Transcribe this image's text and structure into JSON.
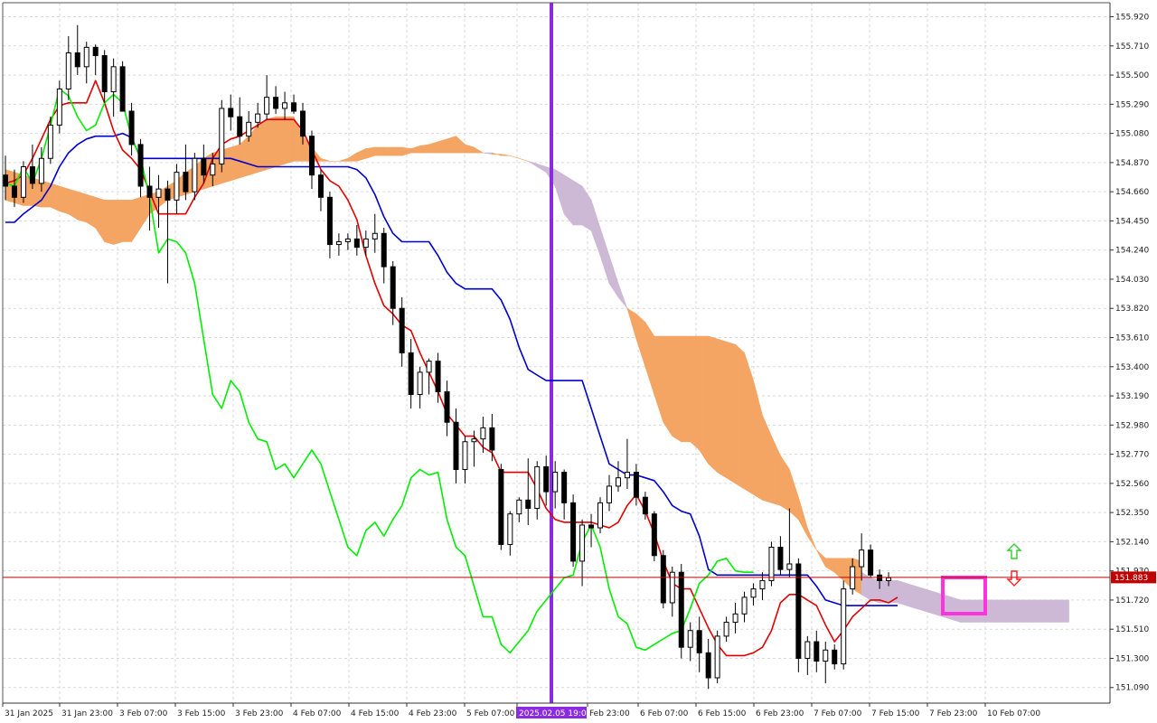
{
  "chart_data": {
    "type": "candlestick",
    "x_tick_labels": [
      "31 Jan 2025",
      "31 Jan 23:00",
      "3 Feb 07:00",
      "3 Feb 15:00",
      "3 Feb 23:00",
      "4 Feb 07:00",
      "4 Feb 15:00",
      "4 Feb 23:00",
      "5 Feb 07:00",
      "2025.02.05 19:00",
      "Feb 23:00",
      "6 Feb 07:00",
      "6 Feb 15:00",
      "6 Feb 23:00",
      "7 Feb 07:00",
      "7 Feb 15:00",
      "7 Feb 23:00",
      "10 Feb 07:00"
    ],
    "y_ticks": [
      155.92,
      155.71,
      155.5,
      155.29,
      155.08,
      154.87,
      154.66,
      154.45,
      154.24,
      154.03,
      153.82,
      153.61,
      153.4,
      153.19,
      152.98,
      152.77,
      152.56,
      152.35,
      152.14,
      151.93,
      151.72,
      151.51,
      151.3,
      151.09
    ],
    "ylim": [
      150.94,
      155.95
    ],
    "current_price": "151.883",
    "current_price_value": 151.883,
    "highlight_label": "2025.02.05 19:00",
    "colors": {
      "tenkan": "#e00000",
      "kijun": "#0000cc",
      "chikou": "#00ee00",
      "cloud_bear": "#cdb8d6",
      "cloud_bull": "#f4a463",
      "vline": "#8a2be2",
      "price_line": "#c00000",
      "box": "#ff33dd",
      "arrow_up": "#33cc33",
      "arrow_down": "#ee2222"
    },
    "candles": [
      [
        154.78,
        154.92,
        154.6,
        154.7
      ],
      [
        154.7,
        154.82,
        154.55,
        154.62
      ],
      [
        154.62,
        154.88,
        154.58,
        154.84
      ],
      [
        154.84,
        155.0,
        154.68,
        154.72
      ],
      [
        154.72,
        154.98,
        154.66,
        154.9
      ],
      [
        154.9,
        155.2,
        154.86,
        155.14
      ],
      [
        155.14,
        155.46,
        155.08,
        155.4
      ],
      [
        155.4,
        155.78,
        155.32,
        155.66
      ],
      [
        155.66,
        155.86,
        155.5,
        155.56
      ],
      [
        155.56,
        155.74,
        155.44,
        155.7
      ],
      [
        155.7,
        155.72,
        155.5,
        155.64
      ],
      [
        155.64,
        155.68,
        155.3,
        155.38
      ],
      [
        155.38,
        155.62,
        155.2,
        155.56
      ],
      [
        155.56,
        155.6,
        155.24,
        155.24
      ],
      [
        155.24,
        155.3,
        154.92,
        155.0
      ],
      [
        155.0,
        155.04,
        154.62,
        154.7
      ],
      [
        154.7,
        154.84,
        154.38,
        154.62
      ],
      [
        154.62,
        154.78,
        154.4,
        154.68
      ],
      [
        154.68,
        154.74,
        154.0,
        154.6
      ],
      [
        154.6,
        154.86,
        154.5,
        154.8
      ],
      [
        154.8,
        155.0,
        154.6,
        154.66
      ],
      [
        154.66,
        154.94,
        154.6,
        154.9
      ],
      [
        154.9,
        155.0,
        154.72,
        154.78
      ],
      [
        154.78,
        154.94,
        154.7,
        154.86
      ],
      [
        154.86,
        155.32,
        154.8,
        155.26
      ],
      [
        155.26,
        155.36,
        155.1,
        155.2
      ],
      [
        155.2,
        155.34,
        155.0,
        155.06
      ],
      [
        155.06,
        155.24,
        155.02,
        155.16
      ],
      [
        155.16,
        155.3,
        155.12,
        155.22
      ],
      [
        155.22,
        155.5,
        155.18,
        155.34
      ],
      [
        155.34,
        155.42,
        155.22,
        155.26
      ],
      [
        155.26,
        155.38,
        155.18,
        155.3
      ],
      [
        155.3,
        155.36,
        155.22,
        155.24
      ],
      [
        155.24,
        155.3,
        155.0,
        155.06
      ],
      [
        155.06,
        155.1,
        154.68,
        154.78
      ],
      [
        154.78,
        154.82,
        154.52,
        154.62
      ],
      [
        154.62,
        154.66,
        154.18,
        154.28
      ],
      [
        154.28,
        154.36,
        154.2,
        154.3
      ],
      [
        154.3,
        154.36,
        154.24,
        154.32
      ],
      [
        154.32,
        154.42,
        154.2,
        154.26
      ],
      [
        154.26,
        154.38,
        154.2,
        154.32
      ],
      [
        154.32,
        154.5,
        154.22,
        154.36
      ],
      [
        154.36,
        154.4,
        154.0,
        154.12
      ],
      [
        154.12,
        154.16,
        153.7,
        153.82
      ],
      [
        153.82,
        153.9,
        153.4,
        153.5
      ],
      [
        153.5,
        153.6,
        153.1,
        153.2
      ],
      [
        153.2,
        153.4,
        153.1,
        153.36
      ],
      [
        153.36,
        153.46,
        153.2,
        153.44
      ],
      [
        153.44,
        153.5,
        153.14,
        153.22
      ],
      [
        153.22,
        153.3,
        152.9,
        153.0
      ],
      [
        153.0,
        153.1,
        152.56,
        152.66
      ],
      [
        152.66,
        152.9,
        152.56,
        152.86
      ],
      [
        152.86,
        152.94,
        152.68,
        152.88
      ],
      [
        152.88,
        153.04,
        152.78,
        152.96
      ],
      [
        152.96,
        153.06,
        152.72,
        152.8
      ],
      [
        152.66,
        152.7,
        152.08,
        152.12
      ],
      [
        152.12,
        152.36,
        152.04,
        152.34
      ],
      [
        152.34,
        152.46,
        152.28,
        152.44
      ],
      [
        152.44,
        152.74,
        152.26,
        152.38
      ],
      [
        152.38,
        152.72,
        152.3,
        152.68
      ],
      [
        152.68,
        152.76,
        152.4,
        152.5
      ],
      [
        152.5,
        152.72,
        152.38,
        152.64
      ],
      [
        152.64,
        152.66,
        152.3,
        152.42
      ],
      [
        152.42,
        152.48,
        151.96,
        152.0
      ],
      [
        152.0,
        152.3,
        151.82,
        152.26
      ],
      [
        152.26,
        152.34,
        152.1,
        152.24
      ],
      [
        152.24,
        152.46,
        152.2,
        152.42
      ],
      [
        152.42,
        152.62,
        152.36,
        152.54
      ],
      [
        152.54,
        152.72,
        152.5,
        152.6
      ],
      [
        152.6,
        152.88,
        152.52,
        152.64
      ],
      [
        152.64,
        152.7,
        152.4,
        152.46
      ],
      [
        152.46,
        152.5,
        152.3,
        152.34
      ],
      [
        152.34,
        152.36,
        152.0,
        152.04
      ],
      [
        152.04,
        152.08,
        151.66,
        151.7
      ],
      [
        151.7,
        151.96,
        151.6,
        151.92
      ],
      [
        151.92,
        151.98,
        151.3,
        151.38
      ],
      [
        151.38,
        151.56,
        151.28,
        151.5
      ],
      [
        151.5,
        151.6,
        151.2,
        151.34
      ],
      [
        151.34,
        151.44,
        151.08,
        151.16
      ],
      [
        151.16,
        151.5,
        151.12,
        151.46
      ],
      [
        151.46,
        151.6,
        151.42,
        151.56
      ],
      [
        151.56,
        151.7,
        151.48,
        151.62
      ],
      [
        151.62,
        151.78,
        151.56,
        151.74
      ],
      [
        151.74,
        151.84,
        151.68,
        151.8
      ],
      [
        151.8,
        151.92,
        151.72,
        151.86
      ],
      [
        151.86,
        152.14,
        151.82,
        152.1
      ],
      [
        152.1,
        152.18,
        151.9,
        151.94
      ],
      [
        151.94,
        152.38,
        151.88,
        151.98
      ],
      [
        151.98,
        152.02,
        151.2,
        151.3
      ],
      [
        151.3,
        151.46,
        151.18,
        151.42
      ],
      [
        151.42,
        151.5,
        151.2,
        151.28
      ],
      [
        151.28,
        151.42,
        151.12,
        151.36
      ],
      [
        151.36,
        151.4,
        151.22,
        151.26
      ],
      [
        151.26,
        151.86,
        151.22,
        151.8
      ],
      [
        151.8,
        152.02,
        151.76,
        151.96
      ],
      [
        151.96,
        152.2,
        151.86,
        152.08
      ],
      [
        152.08,
        152.12,
        151.88,
        151.9
      ],
      [
        151.9,
        151.94,
        151.8,
        151.86
      ],
      [
        151.86,
        151.92,
        151.82,
        151.88
      ]
    ],
    "tenkan": [
      154.72,
      154.74,
      154.78,
      154.9,
      155.04,
      155.18,
      155.28,
      155.3,
      155.3,
      155.3,
      155.46,
      155.3,
      155.1,
      154.96,
      154.9,
      154.82,
      154.66,
      154.5,
      154.5,
      154.5,
      154.5,
      154.62,
      154.72,
      154.9,
      155.0,
      155.04,
      155.06,
      155.1,
      155.14,
      155.18,
      155.18,
      155.18,
      155.18,
      155.1,
      154.96,
      154.82,
      154.74,
      154.7,
      154.6,
      154.46,
      154.2,
      154.0,
      153.84,
      153.78,
      153.7,
      153.66,
      153.5,
      153.36,
      153.22,
      153.06,
      152.98,
      152.9,
      152.9,
      152.82,
      152.78,
      152.64,
      152.64,
      152.64,
      152.64,
      152.52,
      152.38,
      152.3,
      152.28,
      152.28,
      152.28,
      152.28,
      152.26,
      152.24,
      152.28,
      152.4,
      152.48,
      152.36,
      152.2,
      152.0,
      151.84,
      151.8,
      151.8,
      151.66,
      151.52,
      151.4,
      151.32,
      151.32,
      151.32,
      151.34,
      151.38,
      151.5,
      151.7,
      151.76,
      151.76,
      151.72,
      151.68,
      151.54,
      151.42,
      151.5,
      151.6,
      151.66,
      151.72,
      151.72,
      151.7,
      151.74
    ],
    "kijun": [
      154.44,
      154.44,
      154.5,
      154.55,
      154.6,
      154.7,
      154.84,
      154.94,
      155.0,
      155.04,
      155.06,
      155.06,
      155.06,
      155.08,
      155.05,
      154.9,
      154.9,
      154.9,
      154.9,
      154.9,
      154.9,
      154.9,
      154.9,
      154.9,
      154.9,
      154.9,
      154.88,
      154.86,
      154.84,
      154.84,
      154.84,
      154.84,
      154.84,
      154.84,
      154.84,
      154.84,
      154.84,
      154.84,
      154.84,
      154.82,
      154.76,
      154.64,
      154.48,
      154.36,
      154.3,
      154.3,
      154.3,
      154.3,
      154.2,
      154.08,
      154.0,
      153.96,
      153.96,
      153.96,
      153.96,
      153.88,
      153.74,
      153.54,
      153.38,
      153.34,
      153.3,
      153.3,
      153.3,
      153.3,
      153.3,
      153.1,
      152.9,
      152.7,
      152.66,
      152.62,
      152.62,
      152.6,
      152.58,
      152.5,
      152.4,
      152.36,
      152.34,
      152.18,
      151.94,
      151.9,
      151.9,
      151.9,
      151.9,
      151.9,
      151.9,
      151.9,
      151.9,
      151.9,
      151.9,
      151.9,
      151.82,
      151.72,
      151.7,
      151.68,
      151.68,
      151.68,
      151.68,
      151.68,
      151.68,
      151.68
    ],
    "chikou": [
      154.72,
      154.7,
      154.84,
      154.72,
      154.9,
      155.14,
      155.4,
      155.35,
      155.2,
      155.1,
      155.14,
      155.3,
      155.36,
      155.3,
      155.05,
      154.9,
      154.62,
      154.22,
      154.32,
      154.3,
      154.22,
      154.0,
      153.6,
      153.2,
      153.1,
      153.3,
      153.22,
      153.0,
      152.88,
      152.86,
      152.66,
      152.7,
      152.6,
      152.7,
      152.8,
      152.7,
      152.5,
      152.3,
      152.1,
      152.04,
      152.22,
      152.28,
      152.18,
      152.3,
      152.4,
      152.6,
      152.66,
      152.62,
      152.64,
      152.3,
      152.1,
      152.04,
      151.82,
      151.6,
      151.6,
      151.4,
      151.34,
      151.42,
      151.5,
      151.64,
      151.72,
      151.8,
      151.88,
      151.9,
      152.14,
      152.26,
      152.1,
      151.8,
      151.6,
      151.55,
      151.38,
      151.36,
      151.4,
      151.44,
      151.48,
      151.5,
      151.66,
      151.84,
      151.9,
      152.0,
      152.02,
      151.93,
      151.92,
      151.92
    ],
    "cloud_a": [
      154.82,
      154.8,
      154.78,
      154.76,
      154.74,
      154.72,
      154.7,
      154.68,
      154.66,
      154.64,
      154.62,
      154.6,
      154.6,
      154.6,
      154.6,
      154.62,
      154.64,
      154.66,
      154.7,
      154.74,
      154.8,
      154.84,
      154.9,
      154.94,
      154.96,
      154.98,
      155.0,
      155.06,
      155.14,
      155.18,
      155.2,
      155.2,
      155.2,
      155.06,
      154.98,
      154.9,
      154.88,
      154.88,
      154.9,
      154.94,
      154.97,
      154.98,
      154.98,
      154.98,
      154.98,
      154.97,
      154.99,
      155.0,
      155.02,
      155.04,
      155.06,
      155.0,
      154.98,
      154.94,
      154.93,
      154.93,
      154.92,
      154.9,
      154.88,
      154.84,
      154.8,
      154.7,
      154.5,
      154.42,
      154.42,
      154.38,
      154.2,
      154.0,
      153.9,
      153.82,
      153.78,
      153.72,
      153.62,
      153.62,
      153.62,
      153.62,
      153.62,
      153.62,
      153.62,
      153.6,
      153.58,
      153.56,
      153.5,
      153.3,
      153.05,
      152.9,
      152.76,
      152.66,
      152.46,
      152.24,
      152.08,
      152.02,
      152.02,
      152.02,
      152.02,
      152.0
    ],
    "cloud_b": [
      154.6,
      154.58,
      154.56,
      154.56,
      154.55,
      154.55,
      154.52,
      154.5,
      154.46,
      154.44,
      154.4,
      154.3,
      154.28,
      154.3,
      154.3,
      154.4,
      154.5,
      154.55,
      154.6,
      154.62,
      154.64,
      154.66,
      154.68,
      154.7,
      154.72,
      154.74,
      154.76,
      154.78,
      154.8,
      154.82,
      154.84,
      154.86,
      154.88,
      154.88,
      154.88,
      154.88,
      154.88,
      154.88,
      154.88,
      154.88,
      154.9,
      154.92,
      154.92,
      154.92,
      154.92,
      154.94,
      154.94,
      154.94,
      154.94,
      154.94,
      154.94,
      154.94,
      154.94,
      154.94,
      154.94,
      154.92,
      154.92,
      154.9,
      154.88,
      154.86,
      154.84,
      154.82,
      154.78,
      154.74,
      154.7,
      154.6,
      154.4,
      154.2,
      154.0,
      153.82,
      153.6,
      153.4,
      153.2,
      153.0,
      152.9,
      152.86,
      152.86,
      152.8,
      152.7,
      152.64,
      152.6,
      152.56,
      152.52,
      152.48,
      152.44,
      152.42,
      152.4,
      152.36,
      152.3,
      152.18,
      152.08,
      151.96,
      151.92,
      151.86,
      151.8,
      151.76,
      151.72,
      151.7,
      151.7,
      151.7,
      151.68,
      151.66,
      151.64,
      151.62,
      151.6,
      151.58,
      151.56,
      151.56,
      151.56,
      151.56,
      151.56,
      151.56,
      151.56,
      151.56,
      151.56,
      151.56,
      151.56,
      151.56,
      151.56
    ]
  }
}
